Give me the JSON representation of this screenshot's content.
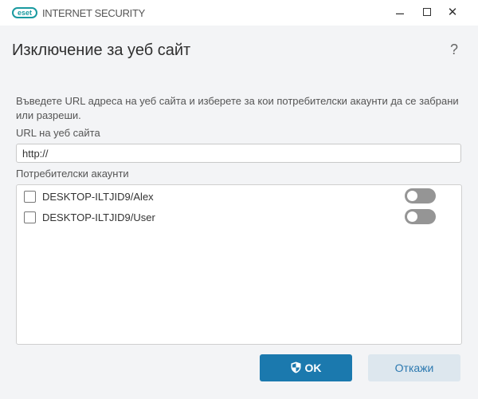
{
  "titlebar": {
    "logo": "eset",
    "product": "INTERNET SECURITY",
    "minimize": "☐",
    "maximize": "☐",
    "close": "✕"
  },
  "dialog": {
    "title": "Изключение за уеб сайт",
    "help": "?",
    "description": "Въведете URL адреса на уеб сайта и изберете за кои потребителски акаунти да се забрани или разреши.",
    "url_label": "URL на уеб сайта",
    "url_value": "http://",
    "accounts_label": "Потребителски акаунти",
    "accounts": [
      {
        "name": "DESKTOP-ILTJID9/Alex",
        "checked": false,
        "enabled": false
      },
      {
        "name": "DESKTOP-ILTJID9/User",
        "checked": false,
        "enabled": false
      }
    ],
    "ok": "OK",
    "cancel": "Откажи"
  },
  "colors": {
    "accent": "#1b79ae",
    "logo": "#1a9aa0"
  }
}
